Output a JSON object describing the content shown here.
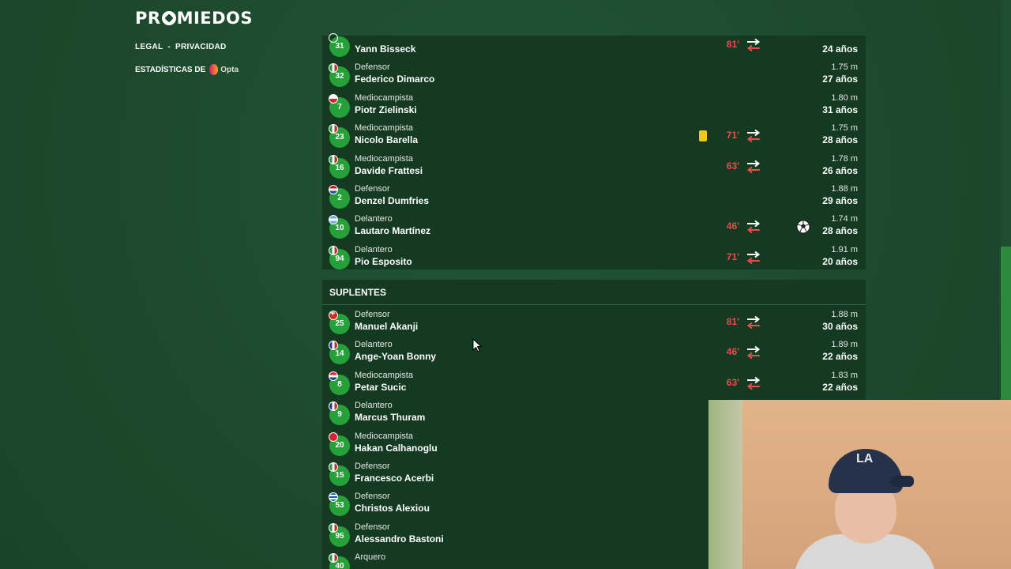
{
  "brand": {
    "logo_pre": "PR",
    "logo_post": "MIEDOS"
  },
  "nav": {
    "legal": "LEGAL",
    "separator": "-",
    "privacy": "PRIVACIDAD",
    "stats_prefix": "ESTADÍSTICAS DE",
    "opta": "Opta"
  },
  "colors": {
    "card_yellow": "#f4c81b",
    "minute_red": "#ef4b4b",
    "badge_green": "#26a13a"
  },
  "starters": [
    {
      "number": "31",
      "flag": "de",
      "position": "",
      "name": "Yann Bisseck",
      "minute": "81'",
      "sub": true,
      "card": false,
      "goal": false,
      "height": "",
      "age": "24 años"
    },
    {
      "number": "32",
      "flag": "it",
      "position": "Defensor",
      "name": "Federico Dimarco",
      "minute": "",
      "sub": false,
      "card": false,
      "goal": false,
      "height": "1.75 m",
      "age": "27 años"
    },
    {
      "number": "7",
      "flag": "pl",
      "position": "Mediocampista",
      "name": "Piotr Zielinski",
      "minute": "",
      "sub": false,
      "card": false,
      "goal": false,
      "height": "1.80 m",
      "age": "31 años"
    },
    {
      "number": "23",
      "flag": "it",
      "position": "Mediocampista",
      "name": "Nicolo Barella",
      "minute": "71'",
      "sub": true,
      "card": true,
      "goal": false,
      "height": "1.75 m",
      "age": "28 años"
    },
    {
      "number": "16",
      "flag": "it",
      "position": "Mediocampista",
      "name": "Davide Frattesi",
      "minute": "63'",
      "sub": true,
      "card": false,
      "goal": false,
      "height": "1.78 m",
      "age": "26 años"
    },
    {
      "number": "2",
      "flag": "nl",
      "position": "Defensor",
      "name": "Denzel Dumfries",
      "minute": "",
      "sub": false,
      "card": false,
      "goal": false,
      "height": "1.88 m",
      "age": "29 años"
    },
    {
      "number": "10",
      "flag": "ar",
      "position": "Delantero",
      "name": "Lautaro Martínez",
      "minute": "46'",
      "sub": true,
      "card": false,
      "goal": true,
      "height": "1.74 m",
      "age": "28 años"
    },
    {
      "number": "94",
      "flag": "it",
      "position": "Delantero",
      "name": "Pio Esposito",
      "minute": "71'",
      "sub": true,
      "card": false,
      "goal": false,
      "height": "1.91 m",
      "age": "20 años"
    }
  ],
  "subs_title": "SUPLENTES",
  "subs": [
    {
      "number": "25",
      "flag": "ch",
      "position": "Defensor",
      "name": "Manuel Akanji",
      "minute": "81'",
      "sub": true,
      "height": "1.88 m",
      "age": "30 años"
    },
    {
      "number": "14",
      "flag": "fr",
      "position": "Delantero",
      "name": "Ange-Yoan Bonny",
      "minute": "46'",
      "sub": true,
      "height": "1.89 m",
      "age": "22 años"
    },
    {
      "number": "8",
      "flag": "hr",
      "position": "Mediocampista",
      "name": "Petar Sucic",
      "minute": "63'",
      "sub": true,
      "height": "1.83 m",
      "age": "22 años"
    },
    {
      "number": "9",
      "flag": "fr",
      "position": "Delantero",
      "name": "Marcus Thuram",
      "minute": "",
      "sub": false,
      "height": "",
      "age": ""
    },
    {
      "number": "20",
      "flag": "tr",
      "position": "Mediocampista",
      "name": "Hakan Calhanoglu",
      "minute": "",
      "sub": false,
      "height": "",
      "age": ""
    },
    {
      "number": "15",
      "flag": "it",
      "position": "Defensor",
      "name": "Francesco Acerbi",
      "minute": "",
      "sub": false,
      "height": "",
      "age": ""
    },
    {
      "number": "53",
      "flag": "gr",
      "position": "Defensor",
      "name": "Christos Alexiou",
      "minute": "",
      "sub": false,
      "height": "",
      "age": ""
    },
    {
      "number": "95",
      "flag": "it",
      "position": "Defensor",
      "name": "Alessandro Bastoni",
      "minute": "",
      "sub": false,
      "height": "",
      "age": ""
    },
    {
      "number": "40",
      "flag": "it",
      "position": "Arquero",
      "name": "",
      "minute": "",
      "sub": false,
      "height": "",
      "age": ""
    }
  ]
}
